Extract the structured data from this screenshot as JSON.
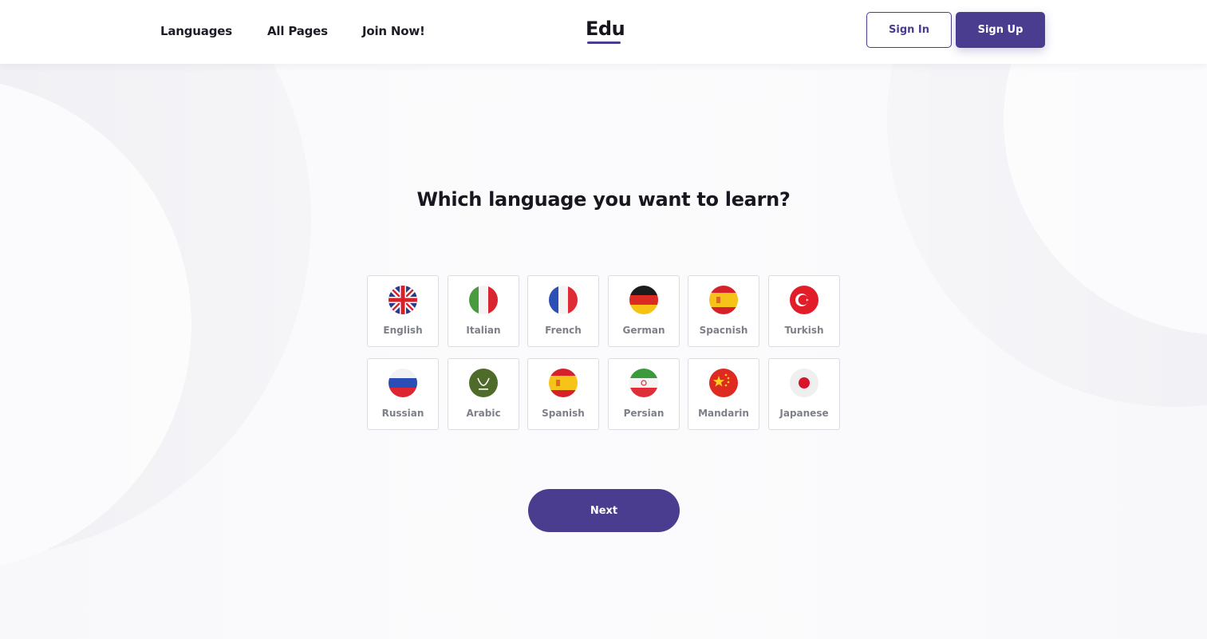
{
  "header": {
    "nav": [
      {
        "label": "Languages"
      },
      {
        "label": "All Pages"
      },
      {
        "label": "Join Now!"
      }
    ],
    "logo": "Edu",
    "sign_in_label": "Sign In",
    "sign_up_label": "Sign Up"
  },
  "main": {
    "question": "Which language you want to learn?",
    "languages": [
      {
        "label": "English",
        "icon": "uk-flag-icon"
      },
      {
        "label": "Italian",
        "icon": "italy-flag-icon"
      },
      {
        "label": "French",
        "icon": "france-flag-icon"
      },
      {
        "label": "German",
        "icon": "germany-flag-icon"
      },
      {
        "label": "Spacnish",
        "icon": "spain-flag-icon"
      },
      {
        "label": "Turkish",
        "icon": "turkey-flag-icon"
      },
      {
        "label": "Russian",
        "icon": "russia-flag-icon"
      },
      {
        "label": "Arabic",
        "icon": "saudi-arabia-flag-icon"
      },
      {
        "label": "Spanish",
        "icon": "spain-flag-icon"
      },
      {
        "label": "Persian",
        "icon": "iran-flag-icon"
      },
      {
        "label": "Mandarin",
        "icon": "china-flag-icon"
      },
      {
        "label": "Japanese",
        "icon": "japan-flag-icon"
      }
    ],
    "next_label": "Next"
  },
  "colors": {
    "accent": "#4a3d8f",
    "text_dark": "#17171f",
    "label_gray": "#7d8089",
    "card_border": "#dcdce3"
  }
}
